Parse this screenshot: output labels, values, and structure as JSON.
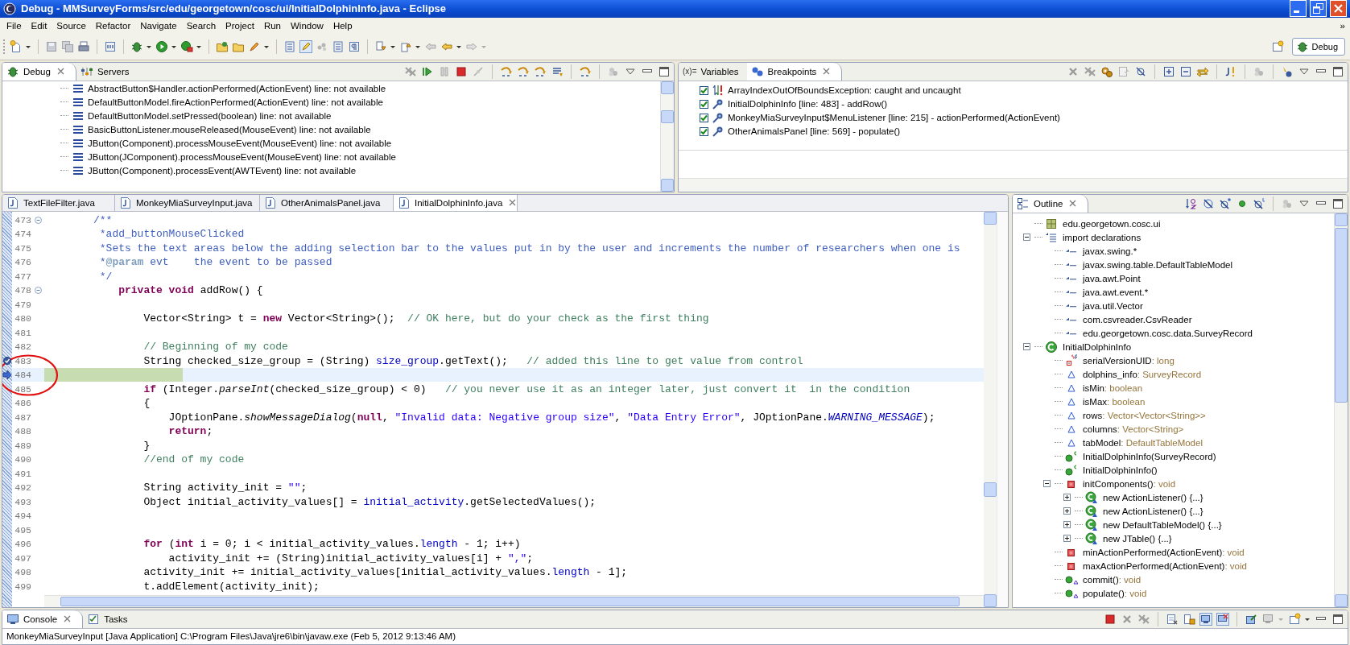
{
  "window": {
    "title": "Debug - MMSurveyForms/src/edu/georgetown/cosc/ui/InitialDolphinInfo.java - Eclipse"
  },
  "menu": [
    "File",
    "Edit",
    "Source",
    "Refactor",
    "Navigate",
    "Search",
    "Project",
    "Run",
    "Window",
    "Help"
  ],
  "menu_overflow": "»",
  "perspectives": [
    {
      "label": "Debug",
      "selected": true
    }
  ],
  "debug_view": {
    "tabs": [
      {
        "label": "Debug",
        "selected": true
      },
      {
        "label": "Servers",
        "selected": false
      }
    ],
    "frames": [
      "AbstractButton$Handler.actionPerformed(ActionEvent) line: not available",
      "DefaultButtonModel.fireActionPerformed(ActionEvent) line: not available",
      "DefaultButtonModel.setPressed(boolean) line: not available",
      "BasicButtonListener.mouseReleased(MouseEvent) line: not available",
      "JButton(Component).processMouseEvent(MouseEvent) line: not available",
      "JButton(JComponent).processMouseEvent(MouseEvent) line: not available",
      "JButton(Component).processEvent(AWTEvent) line: not available"
    ]
  },
  "breakpoints_view": {
    "tabs": [
      {
        "icon_text": "(x)=",
        "label": "Variables",
        "selected": false
      },
      {
        "label": "Breakpoints",
        "selected": true
      }
    ],
    "breakpoints": [
      {
        "kind": "exception",
        "checked": true,
        "label": "ArrayIndexOutOfBoundsException: caught and uncaught"
      },
      {
        "kind": "line",
        "checked": true,
        "label": "InitialDolphinInfo [line: 483] - addRow()"
      },
      {
        "kind": "line",
        "checked": true,
        "label": "MonkeyMiaSurveyInput$MenuListener [line: 215] - actionPerformed(ActionEvent)"
      },
      {
        "kind": "line",
        "checked": true,
        "label": "OtherAnimalsPanel [line: 569] - populate()"
      }
    ]
  },
  "editor": {
    "tabs": [
      {
        "label": "TextFileFilter.java",
        "selected": false
      },
      {
        "label": "MonkeyMiaSurveyInput.java",
        "selected": false
      },
      {
        "label": "OtherAnimalsPanel.java",
        "selected": false
      },
      {
        "label": "InitialDolphinInfo.java",
        "selected": true
      }
    ],
    "lines": [
      {
        "num": "473",
        "expanded": true,
        "segments": [
          {
            "text": "/**",
            "kind": "javadoc"
          }
        ]
      },
      {
        "num": "474",
        "segments": [
          {
            "text": " *add_buttonMouseClicked",
            "kind": "javadoc"
          }
        ]
      },
      {
        "num": "475",
        "segments": [
          {
            "text": " *Sets the text areas below the adding selection bar to the values put in by the user and increments the number of researchers when one is",
            "kind": "javadoc"
          }
        ]
      },
      {
        "num": "476",
        "segments": [
          {
            "text": " *",
            "kind": "javadoc"
          },
          {
            "text": "@param",
            "kind": "tag"
          },
          {
            "text": " evt    the event to be passed",
            "kind": "javadoc"
          }
        ]
      },
      {
        "num": "477",
        "segments": [
          {
            "text": " */",
            "kind": "javadoc"
          }
        ]
      },
      {
        "num": "478",
        "expanded": true,
        "segments": [
          {
            "text": "    private void",
            "kind": "keyword"
          },
          {
            "text": " addRow() {",
            "kind": "plain"
          }
        ]
      },
      {
        "num": "479"
      },
      {
        "num": "480",
        "segments": [
          {
            "text": "        Vector<String> t = ",
            "kind": "plain"
          },
          {
            "text": "new",
            "kind": "keyword"
          },
          {
            "text": " Vector<String>();  ",
            "kind": "plain"
          },
          {
            "text": "// OK here, but do your check as the first thing",
            "kind": "comment"
          }
        ]
      },
      {
        "num": "481"
      },
      {
        "num": "482",
        "segments": [
          {
            "text": "        // Beginning of my code",
            "kind": "comment"
          }
        ]
      },
      {
        "num": "483",
        "breakpoint": true,
        "segments": [
          {
            "text": "        String checked_size_group = (String) ",
            "kind": "plain"
          },
          {
            "text": "size_group",
            "kind": "field"
          },
          {
            "text": ".getText();   ",
            "kind": "plain"
          },
          {
            "text": "// added this line to get value from control",
            "kind": "comment"
          }
        ]
      },
      {
        "num": "484",
        "current": true
      },
      {
        "num": "485",
        "segments": [
          {
            "text": "        if",
            "kind": "keyword"
          },
          {
            "text": " (Integer.",
            "kind": "plain"
          },
          {
            "text": "parseInt",
            "kind": "static_method"
          },
          {
            "text": "(checked_size_group) < 0)   ",
            "kind": "plain"
          },
          {
            "text": "// you never use it as an integer later, just convert it  in the condition",
            "kind": "comment"
          }
        ]
      },
      {
        "num": "486",
        "segments": [
          {
            "text": "        {",
            "kind": "plain"
          }
        ]
      },
      {
        "num": "487",
        "segments": [
          {
            "text": "            JOptionPane.",
            "kind": "plain"
          },
          {
            "text": "showMessageDialog",
            "kind": "static_method"
          },
          {
            "text": "(",
            "kind": "plain"
          },
          {
            "text": "null",
            "kind": "keyword"
          },
          {
            "text": ", ",
            "kind": "plain"
          },
          {
            "text": "\"Invalid data: Negative group size\"",
            "kind": "string"
          },
          {
            "text": ", ",
            "kind": "plain"
          },
          {
            "text": "\"Data Entry Error\"",
            "kind": "string"
          },
          {
            "text": ", JOptionPane.",
            "kind": "plain"
          },
          {
            "text": "WARNING_MESSAGE",
            "kind": "static_field"
          },
          {
            "text": ");",
            "kind": "plain"
          }
        ]
      },
      {
        "num": "488",
        "segments": [
          {
            "text": "            return",
            "kind": "keyword"
          },
          {
            "text": ";",
            "kind": "plain"
          }
        ]
      },
      {
        "num": "489",
        "segments": [
          {
            "text": "        }",
            "kind": "plain"
          }
        ]
      },
      {
        "num": "490",
        "segments": [
          {
            "text": "        //end of my code",
            "kind": "comment"
          }
        ]
      },
      {
        "num": "491"
      },
      {
        "num": "492",
        "segments": [
          {
            "text": "        String activity_init = ",
            "kind": "plain"
          },
          {
            "text": "\"\"",
            "kind": "string"
          },
          {
            "text": ";",
            "kind": "plain"
          }
        ]
      },
      {
        "num": "493",
        "segments": [
          {
            "text": "        Object initial_activity_values[] = ",
            "kind": "plain"
          },
          {
            "text": "initial_activity",
            "kind": "field"
          },
          {
            "text": ".getSelectedValues();",
            "kind": "plain"
          }
        ]
      },
      {
        "num": "494"
      },
      {
        "num": "495"
      },
      {
        "num": "496",
        "segments": [
          {
            "text": "        for",
            "kind": "keyword"
          },
          {
            "text": " (",
            "kind": "plain"
          },
          {
            "text": "int",
            "kind": "keyword"
          },
          {
            "text": " i = 0; i < initial_activity_values.",
            "kind": "plain"
          },
          {
            "text": "length",
            "kind": "field"
          },
          {
            "text": " - 1; i++)",
            "kind": "plain"
          }
        ]
      },
      {
        "num": "497",
        "segments": [
          {
            "text": "            activity_init += (String)initial_activity_values[i] + ",
            "kind": "plain"
          },
          {
            "text": "\",\"",
            "kind": "string"
          },
          {
            "text": ";",
            "kind": "plain"
          }
        ]
      },
      {
        "num": "498",
        "segments": [
          {
            "text": "        activity_init += initial_activity_values[initial_activity_values.",
            "kind": "plain"
          },
          {
            "text": "length",
            "kind": "field"
          },
          {
            "text": " - 1];",
            "kind": "plain"
          }
        ]
      },
      {
        "num": "499",
        "segments": [
          {
            "text": "        t.addElement(activity_init);",
            "kind": "plain"
          }
        ]
      }
    ]
  },
  "outline": {
    "tabs": [
      {
        "label": "Outline",
        "selected": true
      }
    ],
    "items": [
      {
        "label": "edu.georgetown.cosc.ui",
        "kind": "package"
      },
      {
        "label": "import declarations",
        "kind": "imports",
        "expanded": true,
        "children": [
          {
            "label": "javax.swing.*",
            "kind": "import"
          },
          {
            "label": "javax.swing.table.DefaultTableModel",
            "kind": "import"
          },
          {
            "label": "java.awt.Point",
            "kind": "import"
          },
          {
            "label": "java.awt.event.*",
            "kind": "import"
          },
          {
            "label": "java.util.Vector",
            "kind": "import"
          },
          {
            "label": "com.csvreader.CsvReader",
            "kind": "import"
          },
          {
            "label": "edu.georgetown.cosc.data.SurveyRecord",
            "kind": "import"
          }
        ]
      },
      {
        "label": "InitialDolphinInfo",
        "kind": "class",
        "expanded": true,
        "children": [
          {
            "label": "serialVersionUID",
            "type": ": long",
            "kind": "static_field"
          },
          {
            "label": "dolphins_info",
            "type": ": SurveyRecord",
            "kind": "field"
          },
          {
            "label": "isMin",
            "type": ": boolean",
            "kind": "field"
          },
          {
            "label": "isMax",
            "type": ": boolean",
            "kind": "field"
          },
          {
            "label": "rows",
            "type": ": Vector<Vector<String>>",
            "kind": "field"
          },
          {
            "label": "columns",
            "type": ": Vector<String>",
            "kind": "field"
          },
          {
            "label": "tabModel",
            "type": ": DefaultTableModel",
            "kind": "field"
          },
          {
            "label": "InitialDolphinInfo(SurveyRecord)",
            "kind": "constructor"
          },
          {
            "label": "InitialDolphinInfo()",
            "kind": "constructor"
          },
          {
            "label": "initComponents()",
            "type": ": void",
            "kind": "private_method",
            "expanded": true,
            "children": [
              {
                "label": "new ActionListener() {...}",
                "kind": "anonymous",
                "expanded": false
              },
              {
                "label": "new ActionListener() {...}",
                "kind": "anonymous",
                "expanded": false
              },
              {
                "label": "new DefaultTableModel() {...}",
                "kind": "anonymous",
                "expanded": false
              },
              {
                "label": "new JTable() {...}",
                "kind": "anonymous",
                "expanded": false
              }
            ]
          },
          {
            "label": "minActionPerformed(ActionEvent)",
            "type": ": void",
            "kind": "private_method"
          },
          {
            "label": "maxActionPerformed(ActionEvent)",
            "type": ": void",
            "kind": "private_method"
          },
          {
            "label": "commit()",
            "type": ": void",
            "kind": "method"
          },
          {
            "label": "populate()",
            "type": ": void",
            "kind": "method"
          }
        ]
      }
    ]
  },
  "console": {
    "tabs": [
      {
        "label": "Console",
        "selected": true
      },
      {
        "label": "Tasks",
        "selected": false
      }
    ],
    "text": "MonkeyMiaSurveyInput [Java Application] C:\\Program Files\\Java\\jre6\\bin\\javaw.exe (Feb 5, 2012 9:13:46 AM)"
  }
}
